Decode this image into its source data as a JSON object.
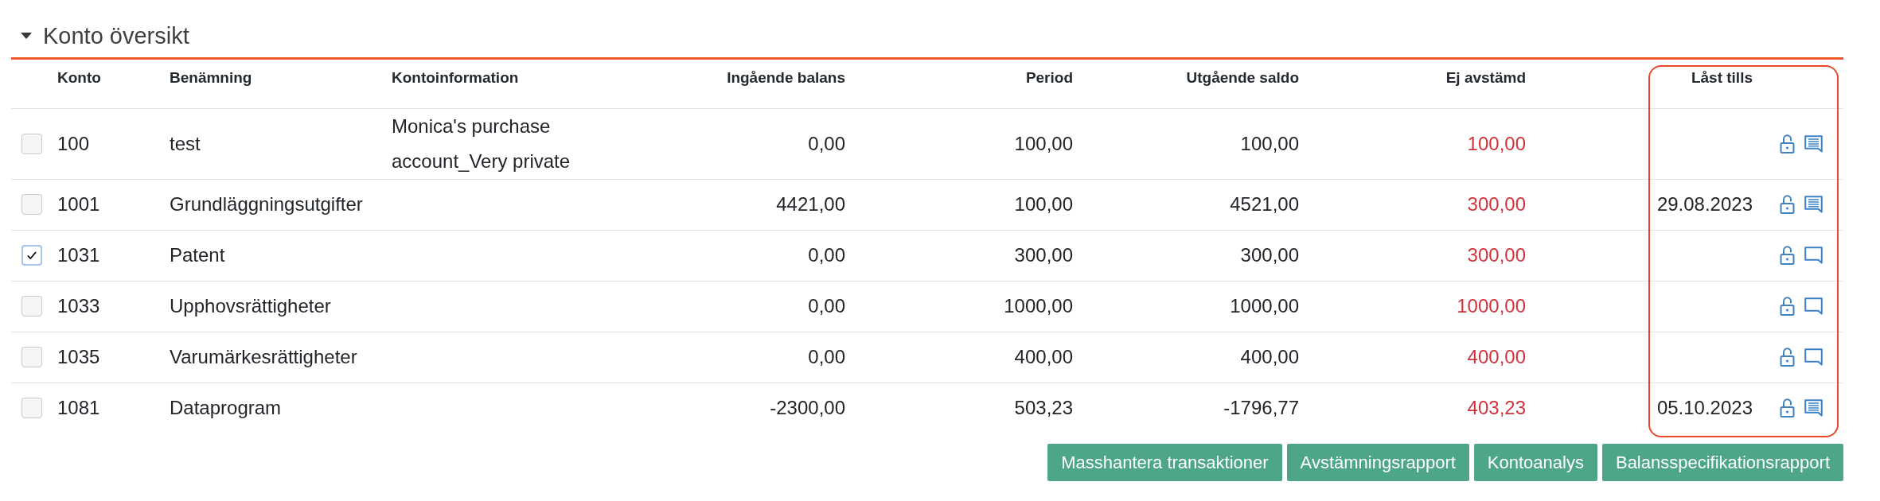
{
  "section": {
    "title": "Konto översikt",
    "expanded": true
  },
  "table": {
    "columns": [
      {
        "label": "Konto",
        "highlighted": false
      },
      {
        "label": "Benämning",
        "highlighted": false
      },
      {
        "label": "Kontoinformation",
        "highlighted": false
      },
      {
        "label": "Ingående balans",
        "highlighted": false
      },
      {
        "label": "Period",
        "highlighted": false
      },
      {
        "label": "Utgående saldo",
        "highlighted": false
      },
      {
        "label": "Ej avstämd",
        "highlighted": false
      },
      {
        "label": "Låst tills",
        "highlighted": true
      }
    ],
    "rows": [
      {
        "checked": false,
        "account": "100",
        "name": "test",
        "info": "Monica's purchase account_Very private",
        "opening_balance": "0,00",
        "period": "100,00",
        "closing_balance": "100,00",
        "unreconciled": "100,00",
        "locked": false,
        "has_comment": true
      },
      {
        "checked": false,
        "account": "1001",
        "name": "Grundläggningsutgifter",
        "opening_balance": "4421,00",
        "period": "100,00",
        "closing_balance": "4521,00",
        "unreconciled": "300,00",
        "locked_until": "29.08.2023",
        "locked": false,
        "has_comment": true
      },
      {
        "checked": true,
        "account": "1031",
        "name": "Patent",
        "opening_balance": "0,00",
        "period": "300,00",
        "closing_balance": "300,00",
        "unreconciled": "300,00",
        "locked": false,
        "has_comment": false
      },
      {
        "checked": false,
        "account": "1033",
        "name": "Upphovsrättigheter",
        "opening_balance": "0,00",
        "period": "1000,00",
        "closing_balance": "1000,00",
        "unreconciled": "1000,00",
        "locked": false,
        "has_comment": false
      },
      {
        "checked": false,
        "account": "1035",
        "name": "Varumärkesrättigheter",
        "opening_balance": "0,00",
        "period": "400,00",
        "closing_balance": "400,00",
        "unreconciled": "400,00",
        "locked": false,
        "has_comment": false
      },
      {
        "checked": false,
        "account": "1081",
        "name": "Dataprogram",
        "opening_balance": "-2300,00",
        "period": "503,23",
        "closing_balance": "-1796,77",
        "unreconciled": "403,23",
        "locked_until": "05.10.2023",
        "locked": false,
        "has_comment": true
      }
    ]
  },
  "buttons": [
    "Masshantera transaktioner",
    "Avstämningsrapport",
    "Kontoanalys",
    "Balansspecifikationsrapport"
  ]
}
